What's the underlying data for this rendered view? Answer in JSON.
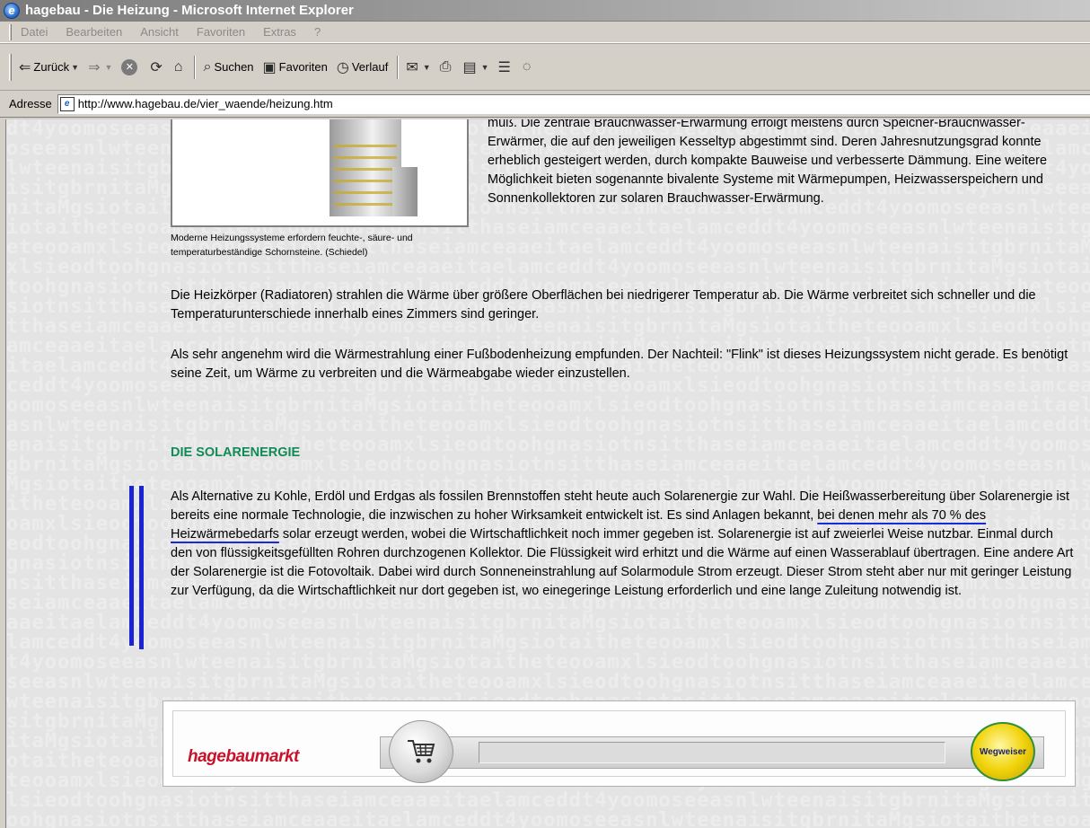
{
  "window": {
    "title": "hagebau - Die Heizung - Microsoft Internet Explorer"
  },
  "menu": [
    "Datei",
    "Bearbeiten",
    "Ansicht",
    "Favoriten",
    "Extras",
    "?"
  ],
  "toolbar": {
    "back_label": "Zurück",
    "search_label": "Suchen",
    "favorites_label": "Favoriten",
    "history_label": "Verlauf"
  },
  "address": {
    "label": "Adresse",
    "url": "http://www.hagebau.de/vier_waende/heizung.htm"
  },
  "content": {
    "right_top_text": "muß. Die zentrale Brauchwasser-Erwärmung erfolgt meistens durch Speicher-Brauchwasser-Erwärmer, die auf den jeweiligen Kesseltyp abgestimmt sind. Deren Jahresnutzungsgrad konnte erheblich gesteigert werden, durch kompakte Bauweise und verbesserte Dämmung. Eine weitere Möglichkeit bieten sogenannte bivalente Systeme mit Wärmepumpen, Heizwasserspeichern und Sonnenkollektoren zur solaren Brauchwasser-Erwärmung.",
    "image_caption": "Moderne Heizungssysteme erfordern feuchte-, säure- und temperaturbeständige Schornsteine. (Schiedel)",
    "para_radiators": "Die Heizkörper (Radiatoren) strahlen die Wärme über größere Oberflächen bei niedrigerer Temperatur ab. Die Wärme verbreitet sich schneller und die Temperaturunterschiede innerhalb eines Zimmers sind geringer.",
    "para_floor": "Als sehr angenehm wird die Wärmestrahlung einer Fußbodenheizung empfunden. Der Nachteil: \"Flink\" ist dieses Heizungssystem nicht gerade. Es benötigt seine Zeit, um Wärme zu verbreiten und die Wärmeabgabe wieder einzustellen.",
    "section_title": "DIE SOLARENERGIE",
    "solar_part1": "Als Alternative zu Kohle, Erdöl und Erdgas als fossilen Brennstoffen steht heute auch Solarenergie zur Wahl. Die Heißwasserbereitung über Solarenergie ist bereits eine normale Technologie, die inzwischen zu hoher Wirksamkeit entwickelt ist. Es sind Anlagen bekannt, ",
    "solar_highlight": "bei denen mehr als 70 % des Heizwärmebedarfs",
    "solar_part2": " solar erzeugt werden, wobei die Wirtschaftlichkeit noch immer gegeben ist. Solarenergie ist auf zweierlei Weise nutzbar. Einmal durch den von flüssigkeitsgefüllten Rohren durchzogenen Kollektor. Die Flüssigkeit wird erhitzt und die Wärme auf einen Wasserablauf übertragen. Eine andere Art der Solarenergie ist die Fotovoltaik. Dabei wird durch Sonneneinstrahlung auf Solarmodule Strom erzeugt. Dieser Strom steht aber nur mit geringer Leistung zur Verfügung, da die Wirtschaftlichkeit nur dort gegeben ist, wo einegeringe Leistung erforderlich und eine lange Zuleitung notwendig ist."
  },
  "banner": {
    "brand": "hagebaumarkt",
    "guide_label": "Wegweiser"
  },
  "colors": {
    "section_title": "#118a57",
    "brand": "#c9122a",
    "annotation": "#1a22d8"
  },
  "icons": [
    "ie-icon",
    "back-arrow-icon",
    "forward-arrow-icon",
    "stop-icon",
    "refresh-icon",
    "home-icon",
    "search-icon",
    "favorites-icon",
    "history-icon",
    "mail-icon",
    "print-icon",
    "edit-icon",
    "discuss-icon",
    "messenger-icon",
    "page-icon",
    "cart-icon",
    "wegweiser-icon"
  ]
}
